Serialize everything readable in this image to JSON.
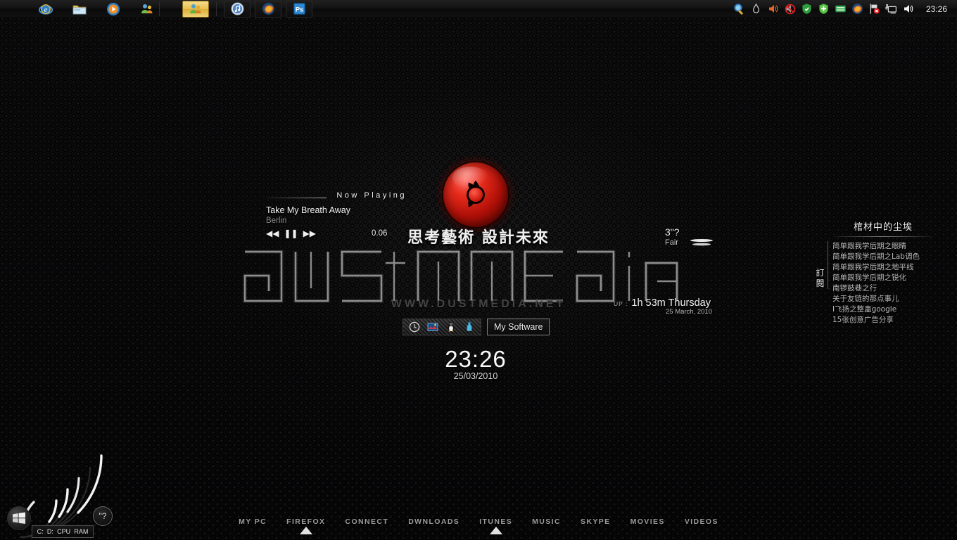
{
  "taskbar": {
    "quick_launch": [
      {
        "name": "internet-explorer",
        "label": "Internet Explorer"
      },
      {
        "name": "windows-explorer",
        "label": "Windows Explorer"
      },
      {
        "name": "media-player",
        "label": "Windows Media Player"
      },
      {
        "name": "windows-live-messenger",
        "label": "Windows Live Messenger"
      }
    ],
    "tasks": [
      {
        "name": "itunes",
        "label": "iTunes",
        "active": false
      },
      {
        "name": "firefox",
        "label": "Mozilla Firefox",
        "active": false
      },
      {
        "name": "photoshop",
        "label": "Adobe Photoshop",
        "active": false
      }
    ],
    "tray": [
      {
        "name": "network-share",
        "label": "Network share"
      },
      {
        "name": "water-drop",
        "label": "Drop"
      },
      {
        "name": "volume-muted",
        "label": "Volume"
      },
      {
        "name": "no-entry",
        "label": "Blocked"
      },
      {
        "name": "security-shield",
        "label": "Security"
      },
      {
        "name": "antivirus-shield",
        "label": "Antivirus"
      },
      {
        "name": "green-card",
        "label": "Card reader"
      },
      {
        "name": "firefox",
        "label": "Firefox"
      },
      {
        "name": "flag-error",
        "label": "Action center"
      },
      {
        "name": "monitor-eject",
        "label": "Safely remove hardware"
      },
      {
        "name": "speaker",
        "label": "Speakers"
      }
    ],
    "clock": "23:26"
  },
  "logo": {
    "tagline": "思考藝術 設計未來",
    "pupil_color": "#d01e10",
    "eye_color": "#c2160b"
  },
  "wordmark": {
    "text": "dustmedia",
    "url": "WWW.DUSTMEDIA.NET"
  },
  "now_playing": {
    "heading": "Now Playing",
    "track": "Take My Breath Away",
    "artist": "Berlin",
    "elapsed": "0.06",
    "controls": [
      {
        "name": "previous-track-button",
        "glyph": "◀◀"
      },
      {
        "name": "pause-button",
        "glyph": "❚❚"
      },
      {
        "name": "next-track-button",
        "glyph": "▶▶"
      }
    ]
  },
  "weather": {
    "temperature": "3\"?",
    "condition": "Fair"
  },
  "system": {
    "uptime_label": "UP :",
    "uptime_value": "1h 53m Thursday",
    "date_long": "25 March, 2010"
  },
  "rss": {
    "title": "棺材中的尘埃",
    "subscribe": "訂閱",
    "items": [
      "简单跟我学后期之眼睛",
      "简单跟我学后期之Lab调色",
      "简单跟我学后期之地平线",
      "简单跟我学后期之锐化",
      "南锣鼓巷之行",
      "关于友链的那点事儿",
      "I飞扬之整蛊google",
      "15张创意广告分享"
    ]
  },
  "mini_dock": {
    "label": "My Software",
    "icons": [
      {
        "name": "clock-icon",
        "label": "Clock"
      },
      {
        "name": "picture-icon",
        "label": "Pictures"
      },
      {
        "name": "penguin-icon",
        "label": "Linux"
      },
      {
        "name": "bottle-icon",
        "label": "Bottle"
      }
    ]
  },
  "clock_widget": {
    "time": "23:26",
    "date": "25/03/2010"
  },
  "gauge": {
    "labels": [
      "C:",
      "D:",
      "CPU",
      "RAM"
    ],
    "values": [
      78,
      44,
      34,
      62
    ],
    "help_badge": "\"?",
    "start_button": "Start"
  },
  "dock_menu": {
    "items": [
      {
        "label": "MY PC",
        "active": false
      },
      {
        "label": "FIREFOX",
        "active": true
      },
      {
        "label": "CONNECT",
        "active": false
      },
      {
        "label": "DWNLOADS",
        "active": false
      },
      {
        "label": "ITUNES",
        "active": true
      },
      {
        "label": "MUSIC",
        "active": false
      },
      {
        "label": "SKYPE",
        "active": false
      },
      {
        "label": "MOVIES",
        "active": false
      },
      {
        "label": "VIDEOS",
        "active": false
      }
    ]
  }
}
